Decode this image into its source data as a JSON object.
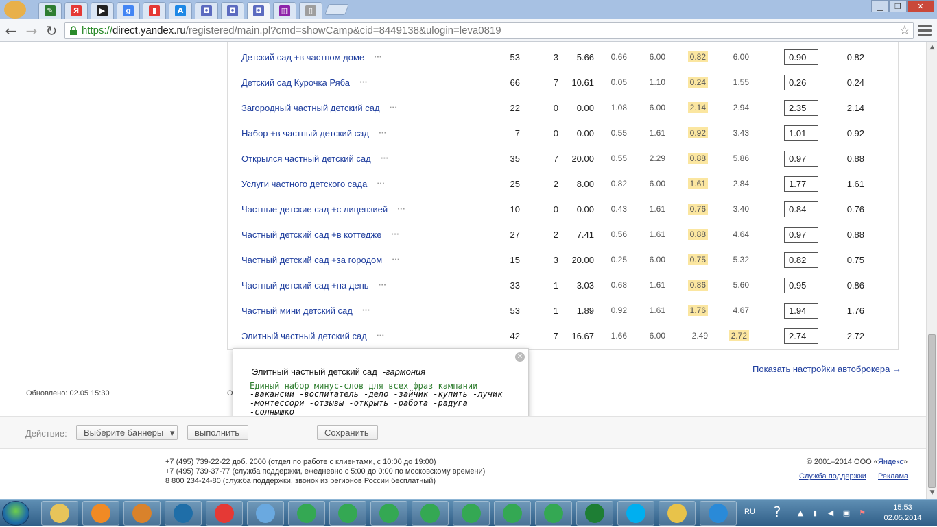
{
  "browser": {
    "url_scheme": "https://",
    "url_host": "direct.yandex.ru",
    "url_path": "/registered/main.pl?cmd=showCamp&cid=8449138&ulogin=leva0819",
    "window_controls": [
      "▁",
      "❐",
      "✕"
    ],
    "tabs": [
      {
        "icon": "camera-icon",
        "glyph": "✎",
        "color": "#2e7d32"
      },
      {
        "icon": "yandex-icon",
        "glyph": "Я",
        "color": "#e53935"
      },
      {
        "icon": "play-icon",
        "glyph": "▶",
        "color": "#222222"
      },
      {
        "icon": "google-icon",
        "glyph": "g",
        "color": "#4285f4"
      },
      {
        "icon": "stats-icon",
        "glyph": "▮",
        "color": "#e53935"
      },
      {
        "icon": "adwords-icon",
        "glyph": "A",
        "color": "#1e88e5"
      },
      {
        "icon": "direct-icon",
        "glyph": "◘",
        "color": "#5c6bc0"
      },
      {
        "icon": "direct-icon",
        "glyph": "◘",
        "color": "#5c6bc0"
      },
      {
        "icon": "direct-icon",
        "glyph": "◘",
        "color": "#5c6bc0",
        "active": true
      },
      {
        "icon": "metrika-icon",
        "glyph": "▥",
        "color": "#8e24aa"
      },
      {
        "icon": "page-icon",
        "glyph": "▯",
        "color": "#9e9e9e"
      }
    ]
  },
  "table": {
    "rows": [
      {
        "phrase": "Детский сад +в частном доме",
        "shows": "53",
        "clicks": "3",
        "ctr": "5.66",
        "a": "0.66",
        "b": "6.00",
        "c": "0.82",
        "d": "6.00",
        "bid": "0.90",
        "price": "0.82",
        "hl": "c"
      },
      {
        "phrase": "Детский сад Курочка Ряба",
        "shows": "66",
        "clicks": "7",
        "ctr": "10.61",
        "a": "0.05",
        "b": "1.10",
        "c": "0.24",
        "d": "1.55",
        "bid": "0.26",
        "price": "0.24",
        "hl": "c"
      },
      {
        "phrase": "Загородный частный детский сад",
        "shows": "22",
        "clicks": "0",
        "ctr": "0.00",
        "a": "1.08",
        "b": "6.00",
        "c": "2.14",
        "d": "2.94",
        "bid": "2.35",
        "price": "2.14",
        "hl": "c"
      },
      {
        "phrase": "Набор +в частный детский сад",
        "shows": "7",
        "clicks": "0",
        "ctr": "0.00",
        "a": "0.55",
        "b": "1.61",
        "c": "0.92",
        "d": "3.43",
        "bid": "1.01",
        "price": "0.92",
        "hl": "c"
      },
      {
        "phrase": "Открылся частный детский сад",
        "shows": "35",
        "clicks": "7",
        "ctr": "20.00",
        "a": "0.55",
        "b": "2.29",
        "c": "0.88",
        "d": "5.86",
        "bid": "0.97",
        "price": "0.88",
        "hl": "c"
      },
      {
        "phrase": "Услуги частного детского сада",
        "shows": "25",
        "clicks": "2",
        "ctr": "8.00",
        "a": "0.82",
        "b": "6.00",
        "c": "1.61",
        "d": "2.84",
        "bid": "1.77",
        "price": "1.61",
        "hl": "c"
      },
      {
        "phrase": "Частные детские сад +с лицензией",
        "shows": "10",
        "clicks": "0",
        "ctr": "0.00",
        "a": "0.43",
        "b": "1.61",
        "c": "0.76",
        "d": "3.40",
        "bid": "0.84",
        "price": "0.76",
        "hl": "c"
      },
      {
        "phrase": "Частный детский сад +в коттедже",
        "shows": "27",
        "clicks": "2",
        "ctr": "7.41",
        "a": "0.56",
        "b": "1.61",
        "c": "0.88",
        "d": "4.64",
        "bid": "0.97",
        "price": "0.88",
        "hl": "c"
      },
      {
        "phrase": "Частный детский сад +за городом",
        "shows": "15",
        "clicks": "3",
        "ctr": "20.00",
        "a": "0.25",
        "b": "6.00",
        "c": "0.75",
        "d": "5.32",
        "bid": "0.82",
        "price": "0.75",
        "hl": "c"
      },
      {
        "phrase": "Частный детский сад +на день",
        "shows": "33",
        "clicks": "1",
        "ctr": "3.03",
        "a": "0.68",
        "b": "1.61",
        "c": "0.86",
        "d": "5.60",
        "bid": "0.95",
        "price": "0.86",
        "hl": "c"
      },
      {
        "phrase": "Частный мини детский сад",
        "shows": "53",
        "clicks": "1",
        "ctr": "1.89",
        "a": "0.92",
        "b": "1.61",
        "c": "1.76",
        "d": "4.67",
        "bid": "1.94",
        "price": "1.76",
        "hl": "c"
      },
      {
        "phrase": "Элитный частный детский сад",
        "shows": "42",
        "clicks": "7",
        "ctr": "16.67",
        "a": "1.66",
        "b": "6.00",
        "c": "2.49",
        "d": "2.72",
        "bid": "2.74",
        "price": "2.72",
        "hl": "d"
      }
    ],
    "dots": "···",
    "highlight_color": "#fbe6a0"
  },
  "popup": {
    "phrase": "Элитный частный детский сад",
    "minus": "-гармония",
    "note": "Единый набор минус-слов для всех фраз кампании",
    "words": "-вакансии -воспитатель -дело -зайчик -купить -лучик -монтессори -отзывы -открыть -работа -радуга -солнышко",
    "close": "✕"
  },
  "autobroker_link": "Показать настройки автоброкера →",
  "updated": "Обновлено: 02.05 15:30",
  "hidden_fragment": "О",
  "actions": {
    "label": "Действие:",
    "select": "Выберите баннеры",
    "select_arrow": "▾",
    "run": "выполнить",
    "save": "Сохранить"
  },
  "footer": {
    "phones": [
      "+7 (495) 739-22-22 доб. 2000 (отдел по работе с клиентами, с 10:00 до 19:00)",
      "+7 (495) 739-37-77 (служба поддержки, ежедневно с 5:00 до 0:00 по московскому времени)",
      "8 800 234-24-80 (служба поддержки, звонок из регионов России бесплатный)"
    ],
    "copyright_prefix": "© 2001–2014  ООО «",
    "copyright_link": "Яндекс",
    "copyright_suffix": "»",
    "support": "Служба поддержки",
    "ads": "Реклама"
  },
  "taskbar": {
    "items": [
      {
        "icon": "explorer-icon",
        "color": "#e7c45a"
      },
      {
        "icon": "media-player-icon",
        "color": "#f08a24"
      },
      {
        "icon": "photo-icon",
        "color": "#d9822b"
      },
      {
        "icon": "hp-icon",
        "color": "#1f6ea8"
      },
      {
        "icon": "yandex-browser-icon",
        "color": "#e53935"
      },
      {
        "icon": "volume-app-icon",
        "color": "#6aa9e0"
      },
      {
        "icon": "chrome-icon",
        "color": "#34a853"
      },
      {
        "icon": "chrome-icon",
        "color": "#34a853"
      },
      {
        "icon": "chrome-icon",
        "color": "#34a853"
      },
      {
        "icon": "chrome-icon",
        "color": "#34a853"
      },
      {
        "icon": "chrome-icon",
        "color": "#34a853"
      },
      {
        "icon": "chrome-icon",
        "color": "#34a853"
      },
      {
        "icon": "chrome-icon",
        "color": "#34a853"
      },
      {
        "icon": "excel-icon",
        "color": "#1e7e34"
      },
      {
        "icon": "skype-icon",
        "color": "#00aff0"
      },
      {
        "icon": "notepad-icon",
        "color": "#e8c34a"
      },
      {
        "icon": "ie-icon",
        "color": "#2a8ad8"
      }
    ],
    "lang": "RU",
    "time": "15:53",
    "date": "02.05.2014"
  }
}
